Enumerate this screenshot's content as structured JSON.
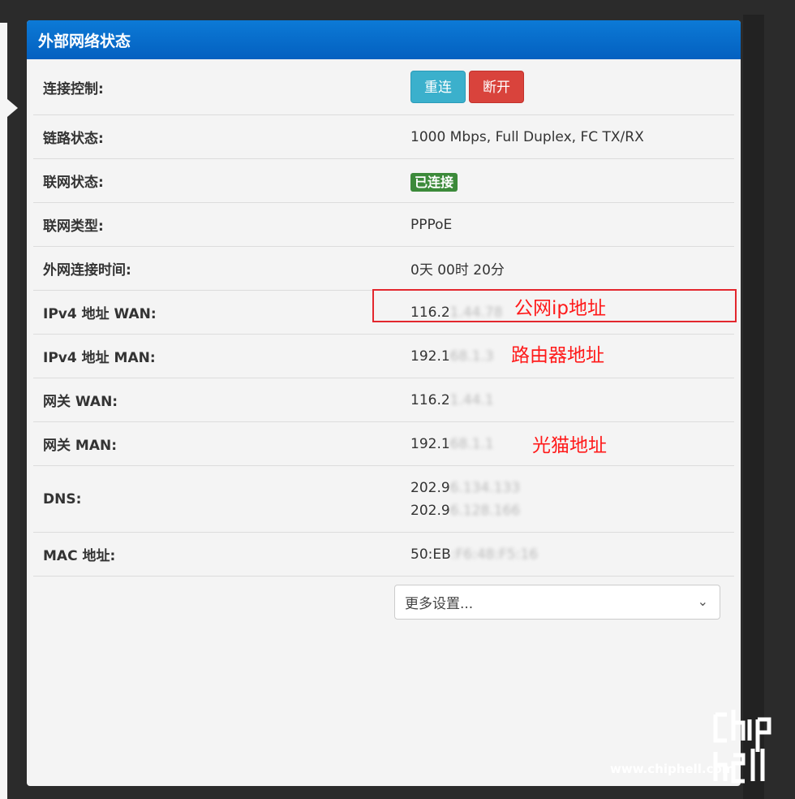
{
  "header": {
    "title": "外部网络状态"
  },
  "rows": [
    {
      "label": "连接控制:"
    },
    {
      "label": "链路状态:",
      "value": "1000 Mbps, Full Duplex, FC TX/RX"
    },
    {
      "label": "联网状态:",
      "badge": "已连接"
    },
    {
      "label": "联网类型:",
      "value": "PPPoE"
    },
    {
      "label": "外网连接时间:",
      "value": "0天 00时 20分"
    },
    {
      "label": "IPv4 地址 WAN:",
      "value_prefix": "116.2",
      "value_masked": "1.44.78"
    },
    {
      "label": "IPv4 地址 MAN:",
      "value_prefix": "192.1",
      "value_masked": "68.1.3"
    },
    {
      "label": "网关 WAN:",
      "value_prefix": "116.2",
      "value_masked": "1.44.1"
    },
    {
      "label": "网关 MAN:",
      "value_prefix": "192.1",
      "value_masked": "68.1.1"
    },
    {
      "label": "DNS:",
      "lines": [
        {
          "prefix": "202.9",
          "masked": "6.134.133"
        },
        {
          "prefix": "202.9",
          "masked": "6.128.166"
        }
      ]
    },
    {
      "label": "MAC 地址:",
      "value_prefix": "50:EB",
      "value_masked": ":F6:48:F5:16"
    }
  ],
  "buttons": {
    "reconnect": "重连",
    "disconnect": "断开"
  },
  "select": {
    "selected": "更多设置..."
  },
  "annotations": {
    "public_ip": "公网ip地址",
    "router": "路由器地址",
    "modem": "光猫地址"
  },
  "watermark": {
    "logo": "chiphell",
    "url": "www.chiphell.com"
  },
  "colors": {
    "header": "#0c7ad6",
    "btn_info": "#3bb0cc",
    "btn_danger": "#d9433c",
    "badge": "#3c8a3a",
    "annotation": "#ff1a1a"
  }
}
